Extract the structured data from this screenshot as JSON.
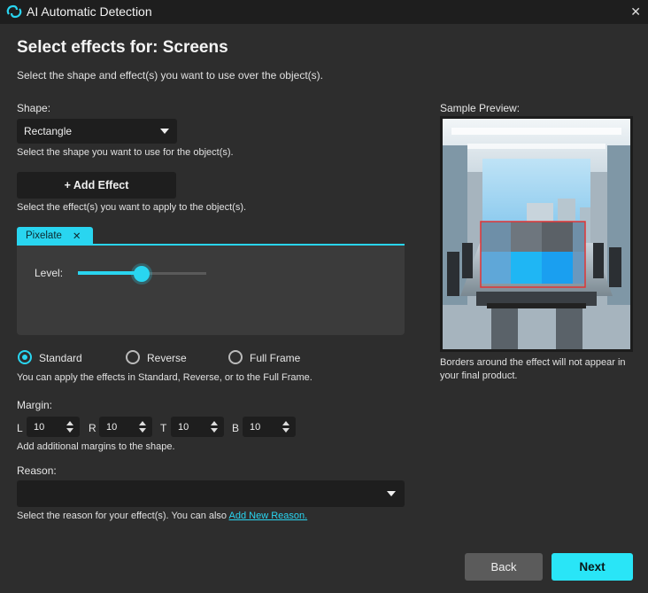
{
  "window": {
    "title": "AI Automatic Detection",
    "close_label": "✕"
  },
  "page": {
    "heading": "Select effects for: Screens",
    "intro": "Select the shape and effect(s) you want to use over the object(s)."
  },
  "shape": {
    "label": "Shape:",
    "selected": "Rectangle",
    "hint": "Select the shape you want to use for the object(s)."
  },
  "add_effect": {
    "label": "+ Add Effect",
    "hint": "Select the effect(s) you want to apply to the object(s)."
  },
  "effect_tab": {
    "label": "Pixelate",
    "close": "✕"
  },
  "level": {
    "label": "Level:",
    "value_fraction": 0.5
  },
  "modes": {
    "options": [
      "Standard",
      "Reverse",
      "Full Frame"
    ],
    "selected": "Standard",
    "hint": "You can apply the effects in Standard, Reverse, or to the Full Frame."
  },
  "margin": {
    "label": "Margin:",
    "fields": [
      {
        "key": "L",
        "value": "10"
      },
      {
        "key": "R",
        "value": "10"
      },
      {
        "key": "T",
        "value": "10"
      },
      {
        "key": "B",
        "value": "10"
      }
    ],
    "hint": "Add additional margins to the shape."
  },
  "reason": {
    "label": "Reason:",
    "selected": "",
    "hint_prefix": "Select the reason for your effect(s). You can also ",
    "link": "Add New Reason."
  },
  "preview": {
    "label": "Sample Preview:",
    "note": "Borders around the effect will not appear in your final product."
  },
  "footer": {
    "back": "Back",
    "next": "Next"
  },
  "colors": {
    "accent": "#29d5f0",
    "bg": "#2d2d2d",
    "field": "#1e1e1e"
  }
}
